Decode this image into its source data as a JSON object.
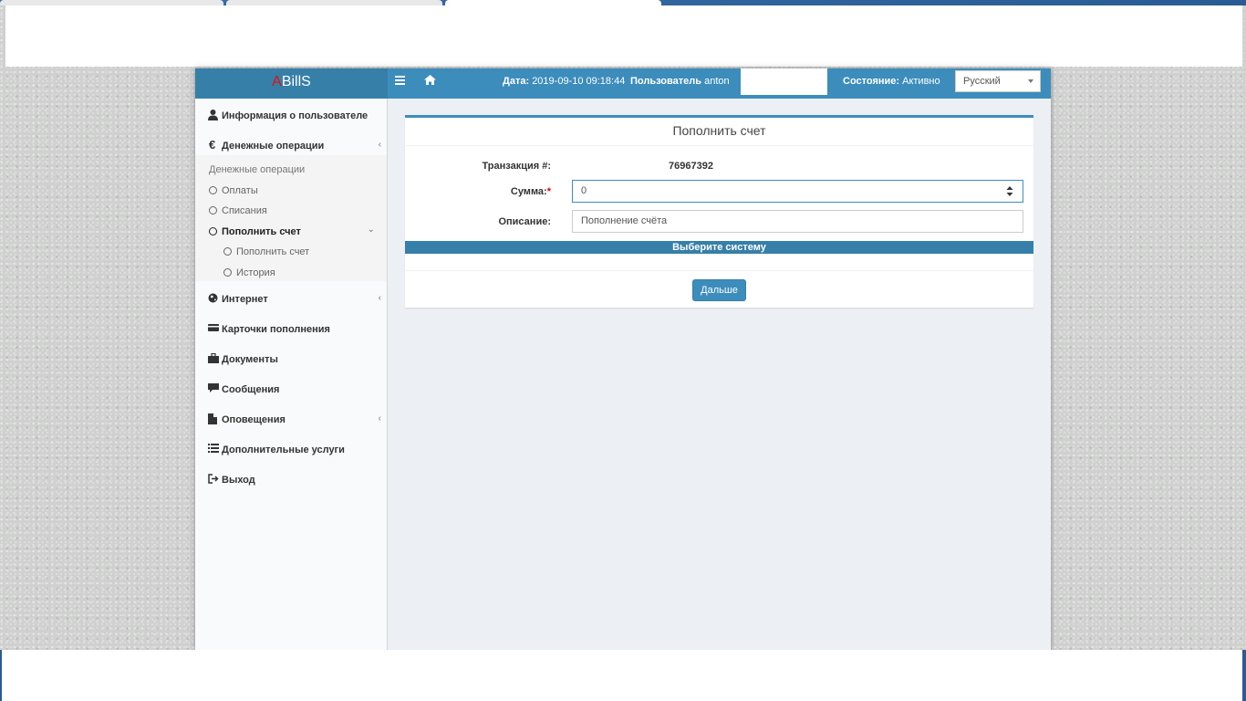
{
  "header": {
    "logo_prefix": "A",
    "logo_rest": "BillS",
    "date_label": "Дата:",
    "date_value": "2019-09-10 09:18:44",
    "user_label": "Пользователь",
    "user_value": "anton",
    "state_label": "Состояние:",
    "state_value": "Активно",
    "language": "Русский"
  },
  "sidebar": {
    "items": [
      {
        "label": "Информация о пользователе",
        "icon": "user-icon"
      },
      {
        "label": "Денежные операции",
        "icon": "euro-icon"
      },
      {
        "label": "Интернет",
        "icon": "globe-icon"
      },
      {
        "label": "Карточки пополнения",
        "icon": "credit-card-icon"
      },
      {
        "label": "Документы",
        "icon": "briefcase-icon"
      },
      {
        "label": "Сообщения",
        "icon": "comment-icon"
      },
      {
        "label": "Оповещения",
        "icon": "file-icon"
      },
      {
        "label": "Дополнительные услуги",
        "icon": "list-icon"
      },
      {
        "label": "Выход",
        "icon": "logout-icon"
      }
    ],
    "sub_header": "Денежные операции",
    "subitems": [
      "Оплаты",
      "Списания",
      "Пополнить счет",
      "Пополнить счет",
      "История"
    ]
  },
  "form": {
    "title": "Пополнить счет",
    "transaction_label": "Транзакция #:",
    "transaction_value": "76967392",
    "sum_label": "Сумма:",
    "required_mark": "*",
    "sum_value": "0",
    "description_label": "Описание:",
    "description_value": "Пополнение счёта",
    "system_bar": "Выберите систему",
    "next_button": "Дальше"
  },
  "colors": {
    "header": "#3c8dbc",
    "logo_bg": "#367fa9",
    "logo_accent": "#e01010",
    "content_bg": "#ecf0f5"
  }
}
